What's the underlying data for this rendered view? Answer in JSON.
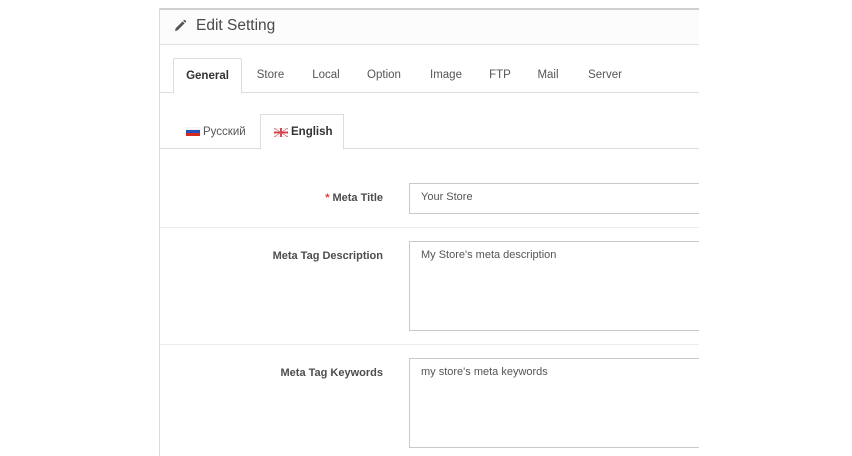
{
  "header": {
    "title": "Edit Setting",
    "icon": "pencil-icon"
  },
  "main_tabs": [
    {
      "label": "General",
      "active": true
    },
    {
      "label": "Store"
    },
    {
      "label": "Local"
    },
    {
      "label": "Option"
    },
    {
      "label": "Image"
    },
    {
      "label": "FTP"
    },
    {
      "label": "Mail"
    },
    {
      "label": "Server"
    }
  ],
  "language_tabs": [
    {
      "label": "Русский",
      "flag": "russian-flag-icon"
    },
    {
      "label": "English",
      "flag": "english-flag-icon",
      "active": true
    }
  ],
  "form": {
    "meta_title": {
      "label": "Meta Title",
      "required_mark": "*",
      "value": "Your Store"
    },
    "meta_description": {
      "label": "Meta Tag Description",
      "value": "My Store's meta description"
    },
    "meta_keywords": {
      "label": "Meta Tag Keywords",
      "value": "my store's meta keywords"
    }
  },
  "colors": {
    "required": "#e03b3b",
    "border": "#dddddd",
    "heading_bg": "#fcfcfc"
  }
}
